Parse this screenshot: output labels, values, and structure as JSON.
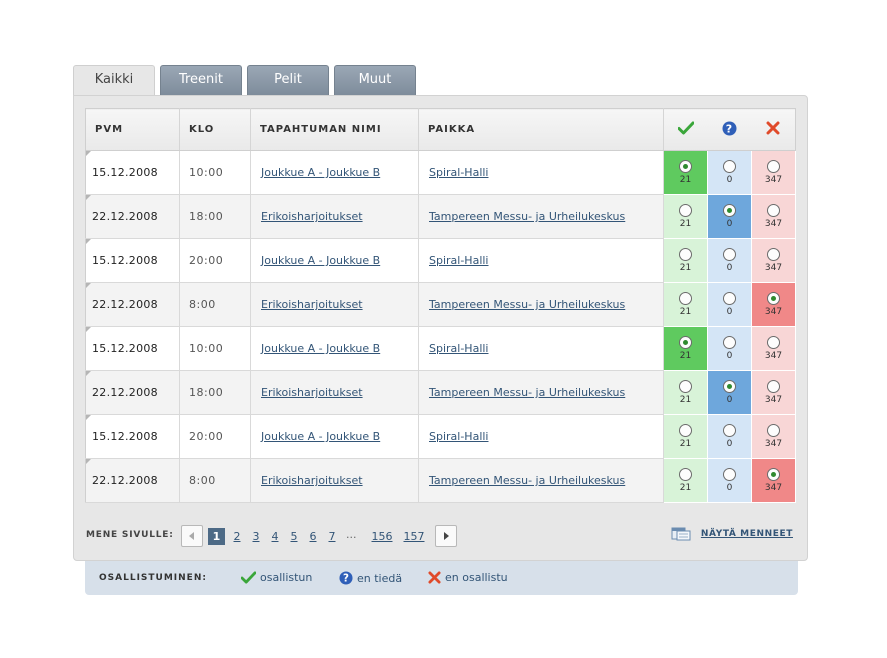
{
  "tabs": [
    {
      "label": "Kaikki",
      "active": true
    },
    {
      "label": "Treenit",
      "active": false
    },
    {
      "label": "Pelit",
      "active": false
    },
    {
      "label": "Muut",
      "active": false
    }
  ],
  "table": {
    "columns": [
      "PVM",
      "KLO",
      "TAPAHTUMAN NIMI",
      "PAIKKA"
    ],
    "vote_icons": [
      "check-icon",
      "question-icon",
      "cross-icon"
    ],
    "rows": [
      {
        "date": "15.12.2008",
        "time": "10:00",
        "event": "Joukkue A - Joukkue B",
        "place": "Spiral-Halli",
        "selected": "yes",
        "counts": [
          "21",
          "0",
          "347"
        ]
      },
      {
        "date": "22.12.2008",
        "time": "18:00",
        "event": "Erikoisharjoitukset",
        "place": "Tampereen Messu- ja Urheilukeskus",
        "selected": "maybe",
        "counts": [
          "21",
          "0",
          "347"
        ]
      },
      {
        "date": "15.12.2008",
        "time": "20:00",
        "event": "Joukkue A - Joukkue B",
        "place": "Spiral-Halli",
        "selected": "none",
        "counts": [
          "21",
          "0",
          "347"
        ]
      },
      {
        "date": "22.12.2008",
        "time": "8:00",
        "event": "Erikoisharjoitukset",
        "place": "Tampereen Messu- ja Urheilukeskus",
        "selected": "no",
        "counts": [
          "21",
          "0",
          "347"
        ]
      },
      {
        "date": "15.12.2008",
        "time": "10:00",
        "event": "Joukkue A - Joukkue B",
        "place": "Spiral-Halli",
        "selected": "yes",
        "counts": [
          "21",
          "0",
          "347"
        ]
      },
      {
        "date": "22.12.2008",
        "time": "18:00",
        "event": "Erikoisharjoitukset",
        "place": "Tampereen Messu- ja Urheilukeskus",
        "selected": "maybe",
        "counts": [
          "21",
          "0",
          "347"
        ]
      },
      {
        "date": "15.12.2008",
        "time": "20:00",
        "event": "Joukkue A - Joukkue B",
        "place": "Spiral-Halli",
        "selected": "none",
        "counts": [
          "21",
          "0",
          "347"
        ]
      },
      {
        "date": "22.12.2008",
        "time": "8:00",
        "event": "Erikoisharjoitukset",
        "place": "Tampereen Messu- ja Urheilukeskus",
        "selected": "no",
        "counts": [
          "21",
          "0",
          "347"
        ]
      }
    ]
  },
  "pager": {
    "label": "MENE SIVULLE:",
    "pages": [
      "1",
      "2",
      "3",
      "4",
      "5",
      "6",
      "7"
    ],
    "ellipsis": "...",
    "last_pages": [
      "156",
      "157"
    ],
    "current": "1"
  },
  "show_past": {
    "label": "NÄYTÄ MENNEET"
  },
  "legend": {
    "label": "OSALLISTUMINEN:",
    "yes": "osallistun",
    "maybe": "en tiedä",
    "no": "en osallistu"
  },
  "colors": {
    "yes": "#5fca5f",
    "maybe": "#6ea7dc",
    "no": "#f08888",
    "link": "#335577"
  }
}
